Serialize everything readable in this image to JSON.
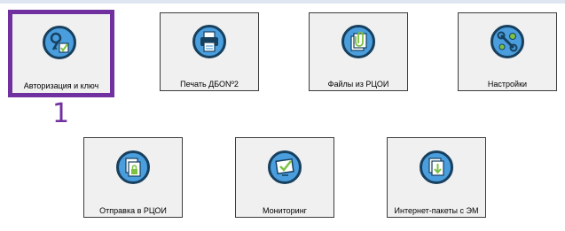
{
  "colors": {
    "selection": "#7030a0",
    "icon_fill": "#4a9edd",
    "icon_ring": "#17405f",
    "icon_accent": "#7dc142",
    "tile_bg": "#f0f0f0"
  },
  "tiles": [
    {
      "label": "Авторизация и ключ",
      "icon": "key-check-icon",
      "selected": true
    },
    {
      "label": "Печать ДБОNº2",
      "icon": "printer-icon",
      "selected": false
    },
    {
      "label": "Файлы из РЦОИ",
      "icon": "clip-file-icon",
      "selected": false
    },
    {
      "label": "Настройки",
      "icon": "wrench-gear-icon",
      "selected": false
    },
    {
      "label": "Отправка в РЦОИ",
      "icon": "lock-docs-icon",
      "selected": false
    },
    {
      "label": "Мониторинг",
      "icon": "monitor-check-icon",
      "selected": false
    },
    {
      "label": "Интернет-пакеты с ЭМ",
      "icon": "download-docs-icon",
      "selected": false
    }
  ],
  "step_marker": "1"
}
